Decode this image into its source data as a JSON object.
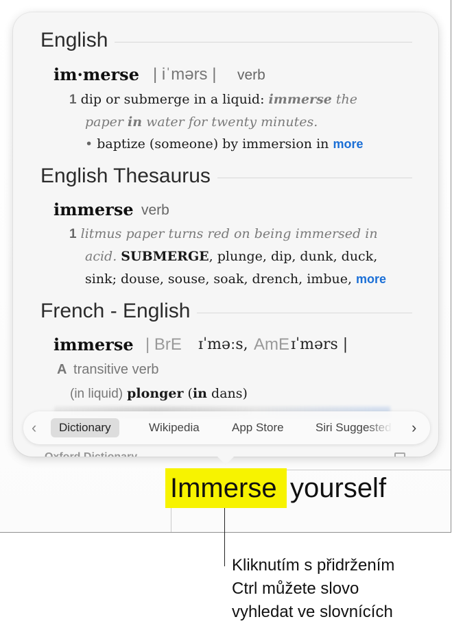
{
  "dictionary": {
    "english": {
      "heading": "English",
      "headword": "im·merse",
      "pronunciation": "| iˈmərs |",
      "pos": "verb",
      "sense_num": "1",
      "definition": "dip or submerge in a liquid",
      "colon": ":",
      "example_part1": "immerse",
      "example_part2": " the",
      "example_line2_a": "paper ",
      "example_line2_b": "in",
      "example_line2_c": " water for twenty minutes.",
      "subsense": "baptize (someone) by immersion in",
      "more": "more"
    },
    "thesaurus": {
      "heading": "English Thesaurus",
      "headword": "immerse",
      "pos": "verb",
      "sense_num": "1",
      "example_line1": "litmus paper turns red on being immersed in",
      "example_line2": "acid.",
      "synonyms_line1_bold": "SUBMERGE",
      "synonyms_line1": ", plunge, dip, dunk, duck,",
      "synonyms_line2": "sink; douse, souse, soak, drench, imbue,",
      "more": "more"
    },
    "french": {
      "heading": "French - English",
      "headword": "immerse",
      "pron_bre_label": "| BrE",
      "pron_bre": "ɪˈməːs,",
      "pron_ame_label": "AmE",
      "pron_ame": "ɪˈmərs |",
      "grammar_letter": "A",
      "grammar": "transitive verb",
      "context": "(in liquid)",
      "translation": "plonger",
      "translation_paren_open": " (",
      "translation_in": "in",
      "translation_rest": " dans)"
    },
    "peek_bottom": "Oxford Dictionary"
  },
  "tabs": {
    "prev_icon": "chevron-left-icon",
    "next_icon": "chevron-right-icon",
    "prev_glyph": "‹",
    "next_glyph": "›",
    "items": [
      {
        "label": "Dictionary",
        "active": true
      },
      {
        "label": "Wikipedia",
        "active": false
      },
      {
        "label": "App Store",
        "active": false
      },
      {
        "label": "Siri Suggested",
        "active": false
      }
    ]
  },
  "document": {
    "selected_word": "Immerse",
    "following_word": "yourself",
    "highlight_color": "#f7f300"
  },
  "callout": {
    "line1": "Kliknutím s přidržením",
    "line2": "Ctrl můžete slovo",
    "line3": "vyhledat ve slovnících"
  }
}
